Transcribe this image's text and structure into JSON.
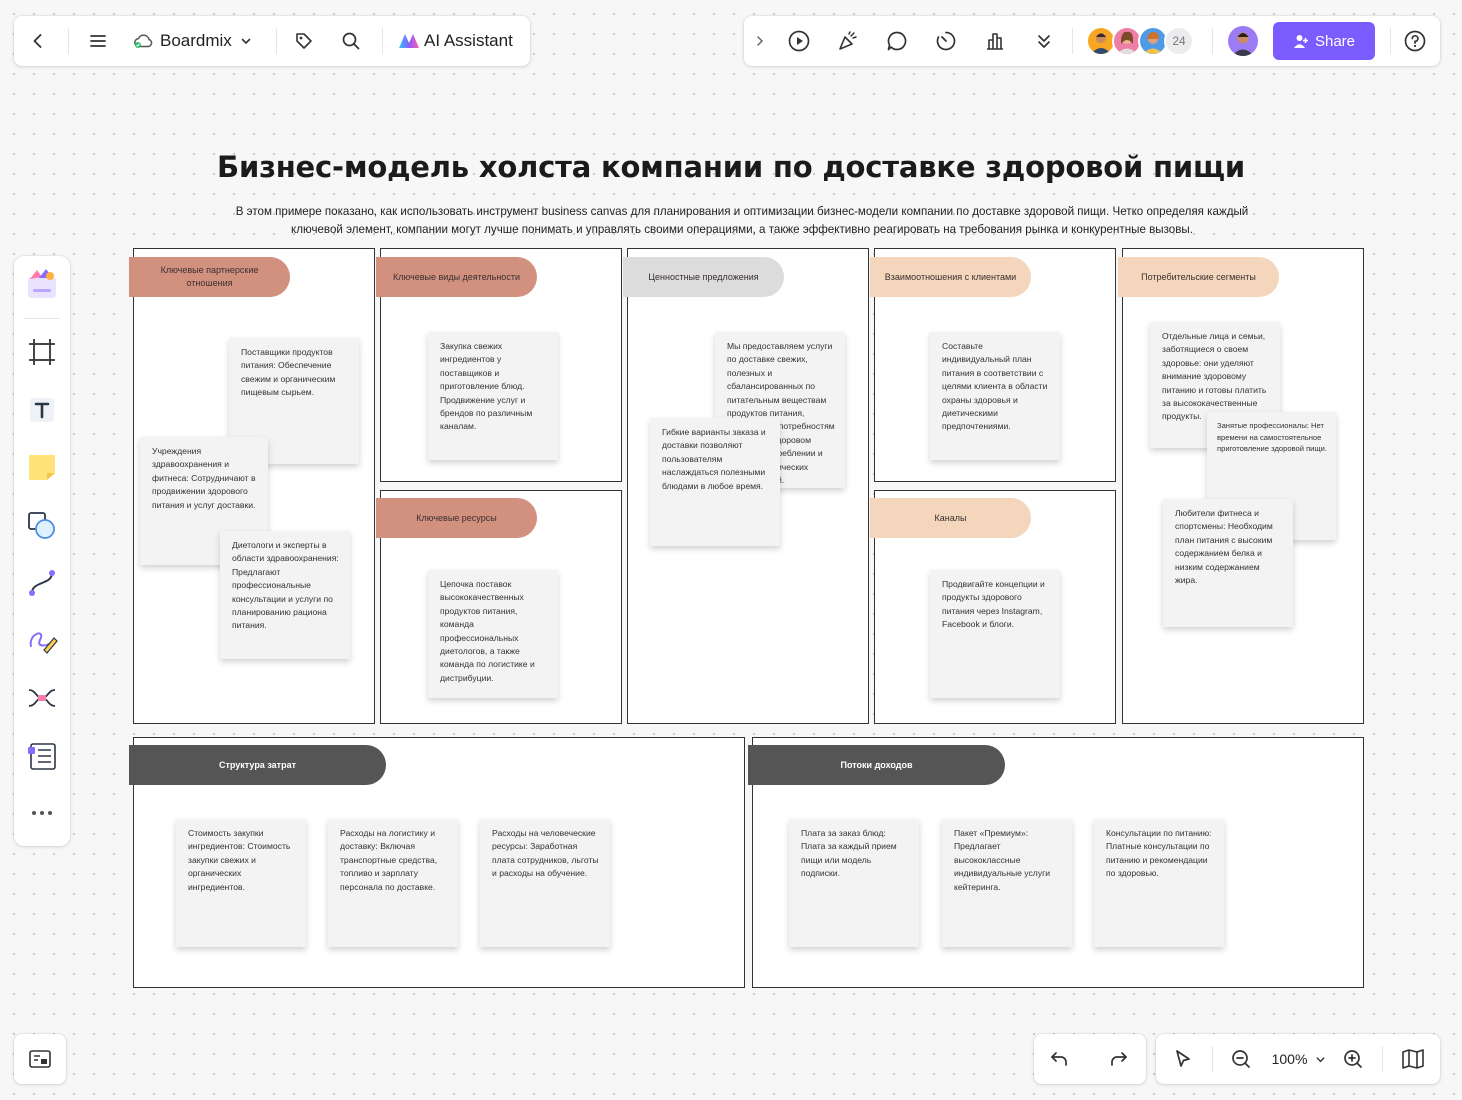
{
  "toolbar_left": {
    "app_name": "Boardmix",
    "ai_label": "AI Assistant"
  },
  "toolbar_right": {
    "collaborator_count": "24",
    "share_label": "Share"
  },
  "board": {
    "title": "Бизнес-модель холста компании по доставке здоровой пищи",
    "description": "В этом примере показано, как использовать инструмент business canvas для планирования и оптимизации бизнес-модели компании по доставке здоровой пищи. Четко определяя каждый ключевой элемент, компании могут лучше понимать и управлять своими операциями, а также эффективно реагировать на требования рынка и конкурентные вызовы.",
    "sections": {
      "partners": {
        "label": "Ключевые партнерские отношения",
        "notes": [
          "Поставщики продуктов питания: Обеспечение свежим и органическим пищевым сырьем.",
          "Учреждения здравоохранения и фитнеса: Сотрудничают в продвижении здорового питания и услуг доставки.",
          "Диетологи и эксперты в области здравоохранения: Предлагают профессиональные консультации и услуги по планированию рациона питания."
        ]
      },
      "activities": {
        "label": "Ключевые виды деятельности",
        "notes": [
          "Закупка свежих ингредиентов у поставщиков и приготовление блюд. Продвижение услуг и брендов по различным каналам."
        ]
      },
      "resources": {
        "label": "Ключевые ресурсы",
        "notes": [
          "Цепочка поставок высококачественных продуктов питания, команда профессиональных диетологов, а также команда по логистике и дистрибуции."
        ]
      },
      "value": {
        "label": "Ценностные предложения",
        "notes": [
          "Мы предоставляем услуги по доставке свежих, полезных и сбалансированных по питательным веществам продуктов питания, отвечающих потребностям клиентов в здоровом питании, потреблении и особых диетических потребностей.",
          "Гибкие варианты заказа и доставки позволяют пользователям наслаждаться полезными блюдами в любое время."
        ]
      },
      "relationships": {
        "label": "Взаимоотношения с клиентами",
        "notes": [
          "Составьте индивидуальный план питания в соответствии с целями клиента в области охраны здоровья и диетическими предпочтениями."
        ]
      },
      "channels": {
        "label": "Каналы",
        "notes": [
          "Продвигайте концепции и продукты здорового питания через Instagram, Facebook и блоги."
        ]
      },
      "segments": {
        "label": "Потребительские сегменты",
        "notes": [
          "Отдельные лица и семьи, заботящиеся о своем здоровье: они уделяют внимание здоровому питанию и готовы платить за высококачественные продукты.",
          "Занятые профессионалы: Нет времени на самостоятельное приготовление здоровой пищи.",
          "Любители фитнеса и спортсмены: Необходим план питания с высоким содержанием белка и низким содержанием жира."
        ]
      },
      "costs": {
        "label": "Структура затрат",
        "notes": [
          "Стоимость закупки ингредиентов: Стоимость закупки свежих и органических ингредиентов.",
          "Расходы на логистику и доставку: Включая транспортные средства, топливо и зарплату персонала по доставке.",
          "Расходы на человеческие ресурсы: Заработная плата сотрудников, льготы и расходы на обучение."
        ]
      },
      "revenue": {
        "label": "Потоки доходов",
        "notes": [
          "Плата за заказ блюд: Плата за каждый прием пищи или модель подписки.",
          "Пакет «Премиум»: Предлагает высококлассные индивидуальные услуги кейтеринга.",
          "Консультации по питанию: Платные консультации по питанию и рекомендации по здоровью."
        ]
      }
    }
  },
  "bottom_bar": {
    "zoom_level": "100%"
  },
  "colors": {
    "accent": "#7b5cff",
    "pill_rose": "#d2907f",
    "pill_grey": "#dcdcdc",
    "pill_peach": "#f3d6bb",
    "pill_dark": "#555555"
  },
  "icons": {
    "left_toolbar": [
      "back-icon",
      "menu-icon",
      "cloud-sync-icon",
      "chevron-down-icon",
      "tag-icon",
      "search-icon",
      "ai-logo-icon"
    ],
    "right_toolbar": [
      "collapse-icon",
      "present-icon",
      "celebrate-icon",
      "comment-icon",
      "timer-icon",
      "vote-icon",
      "more-down-icon",
      "share-user-icon",
      "help-icon"
    ],
    "side_toolbar": [
      "templates-icon",
      "frame-icon",
      "text-icon",
      "sticky-note-icon",
      "shapes-icon",
      "connector-icon",
      "pen-icon",
      "mindmap-icon",
      "table-list-icon",
      "more-icon"
    ],
    "bottom": [
      "minimap-icon",
      "undo-icon",
      "redo-icon",
      "select-icon",
      "zoom-out-icon",
      "zoom-in-icon",
      "book-icon"
    ]
  }
}
